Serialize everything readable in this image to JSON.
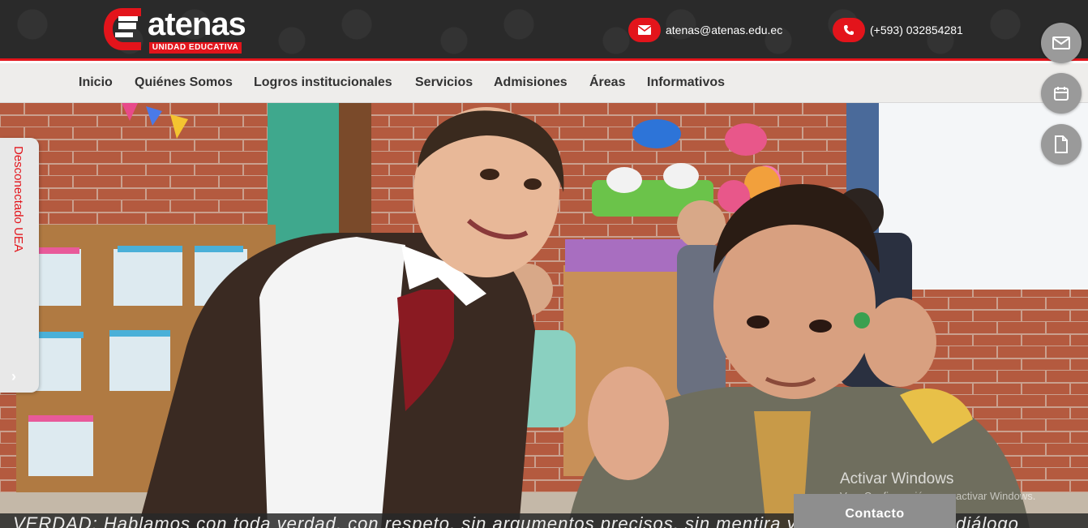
{
  "brand": {
    "name": "atenas",
    "subtitle": "UNIDAD EDUCATIVA",
    "accent_color": "#e3141b"
  },
  "contact": {
    "email": "atenas@atenas.edu.ec",
    "email_icon": "envelope-icon",
    "phone": "(+593) 032854281",
    "phone_icon": "phone-icon"
  },
  "nav": {
    "items": [
      {
        "label": "Inicio"
      },
      {
        "label": "Quiénes Somos"
      },
      {
        "label": "Logros institucionales"
      },
      {
        "label": "Servicios"
      },
      {
        "label": "Admisiones"
      },
      {
        "label": "Áreas"
      },
      {
        "label": "Informativos"
      }
    ]
  },
  "side_tab": {
    "label": "Desconectado UEA",
    "arrow": "›"
  },
  "floating_buttons": [
    {
      "icon": "envelope-icon"
    },
    {
      "icon": "calendar-icon"
    },
    {
      "icon": "document-icon"
    }
  ],
  "hero": {
    "caption": "VERDAD: Hablamos con toda verdad, con respeto, sin argumentos precisos, sin mentira y con principios de diálogo"
  },
  "watermark": {
    "title": "Activar Windows",
    "subtitle": "Ve a Configuración para activar Windows."
  },
  "contacto_tab": {
    "label": "Contacto"
  }
}
